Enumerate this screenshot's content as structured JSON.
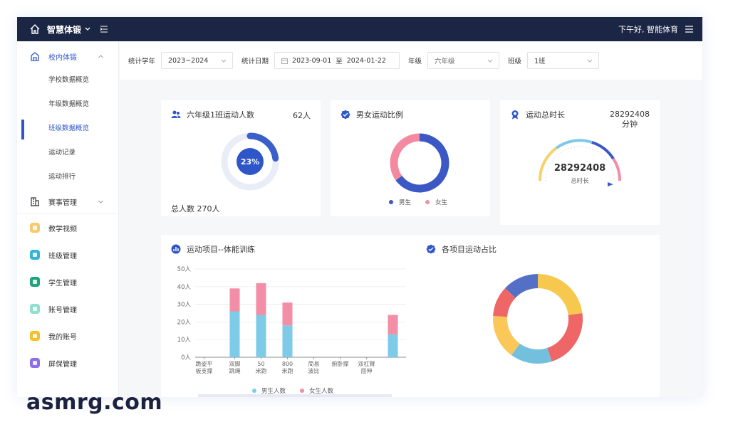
{
  "topbar": {
    "brand": "智慧体锻",
    "greeting": "下午好, 智能体育"
  },
  "sidebar": {
    "group1": "校内体锻",
    "subs": [
      "学校数据概览",
      "年级数据概览",
      "班级数据概览",
      "运动记录",
      "运动排行"
    ],
    "group2": "赛事管理",
    "items": [
      {
        "label": "教学视频",
        "color": "#f7c96a"
      },
      {
        "label": "班级管理",
        "color": "#34b5d6"
      },
      {
        "label": "学生管理",
        "color": "#1ea37c"
      },
      {
        "label": "账号管理",
        "color": "#8fe0d0"
      },
      {
        "label": "我的账号",
        "color": "#f5c02a"
      },
      {
        "label": "屏保管理",
        "color": "#8b6ee8"
      }
    ]
  },
  "filters": {
    "year_label": "统计学年",
    "year_value": "2023~2024",
    "date_label": "统计日期",
    "date_start": "2023-09-01",
    "date_sep": "至",
    "date_end": "2024-01-22",
    "grade_label": "年级",
    "grade_value": "六年级",
    "class_label": "班级",
    "class_value": "1班"
  },
  "card1": {
    "title": "六年级1班运动人数",
    "count": "62人",
    "percent_text": "23%",
    "percent": 0.23,
    "total": "总人数 270人"
  },
  "card2": {
    "title": "男女运动比例",
    "legend_male": "男生",
    "legend_female": "女生",
    "male_ratio": 0.65
  },
  "card3": {
    "title": "运动总时长",
    "value": "28292408",
    "unit": "分钟",
    "gauge_value": "28292408",
    "gauge_label": "总时长"
  },
  "card4": {
    "title": "运动项目--体能训练"
  },
  "card5": {
    "title": "各项目运动占比"
  },
  "colors": {
    "male": "#7ecbe8",
    "female": "#f28fa6",
    "accent": "#2e56c8"
  },
  "chart_data": [
    {
      "type": "bar",
      "title": "运动项目--体能训练",
      "categories": [
        "跪姿平板支撑",
        "双脚跳绳",
        "50米跑",
        "800米跑",
        "简易波比",
        "俯卧撑",
        "双杠臂屈伸"
      ],
      "yticks": [
        "0人",
        "10人",
        "20人",
        "30人",
        "40人",
        "50人"
      ],
      "ylim": [
        0,
        50
      ],
      "stacked": true,
      "series": [
        {
          "name": "男生人数",
          "values": [
            0,
            26,
            24,
            18,
            0,
            0,
            0,
            13
          ]
        },
        {
          "name": "女生人数",
          "values": [
            0,
            13,
            18,
            13,
            0,
            0,
            0,
            11
          ]
        }
      ]
    },
    {
      "type": "pie",
      "title": "各项目运动占比",
      "values": [
        23,
        22,
        15,
        16,
        11,
        13
      ],
      "colors": [
        "#f7c84e",
        "#ee6666",
        "#73c0de",
        "#fac858",
        "#ee6666",
        "#5470c6"
      ]
    }
  ],
  "watermark": "asmrg.com"
}
